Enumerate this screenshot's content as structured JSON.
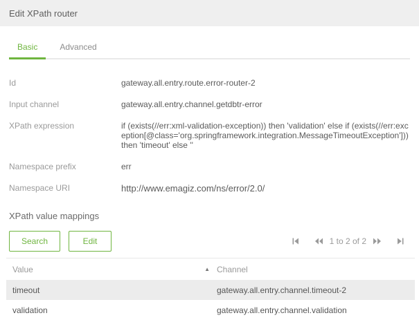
{
  "window": {
    "title": "Edit XPath router"
  },
  "tabs": [
    {
      "label": "Basic",
      "active": true
    },
    {
      "label": "Advanced",
      "active": false
    }
  ],
  "fields": [
    {
      "label": "Id",
      "value": "gateway.all.entry.route.error-router-2"
    },
    {
      "label": "Input channel",
      "value": "gateway.all.entry.channel.getdbtr-error"
    },
    {
      "label": "XPath expression",
      "value": "if (exists(//err:xml-validation-exception)) then 'validation' else if (exists(//err:exception[@class='org.springframework.integration.MessageTimeoutException'])) then 'timeout' else ''"
    },
    {
      "label": "Namespace prefix",
      "value": "err"
    },
    {
      "label": "Namespace URI",
      "value": "http://www.emagiz.com/ns/error/2.0/"
    }
  ],
  "mappings": {
    "section_title": "XPath value mappings",
    "buttons": {
      "search": "Search",
      "edit": "Edit"
    },
    "pagination": {
      "range_text": "1 to 2 of 2",
      "first_icon": "first-page-icon",
      "prev_icon": "previous-page-icon",
      "next_icon": "next-page-icon",
      "last_icon": "last-page-icon"
    },
    "table": {
      "columns": {
        "value": "Value",
        "channel": "Channel"
      },
      "sort": {
        "column": "Value",
        "direction": "ascending",
        "icon": "sort-ascending-icon"
      },
      "rows": [
        {
          "value": "timeout",
          "channel": "gateway.all.entry.channel.timeout-2",
          "highlighted": true
        },
        {
          "value": "validation",
          "channel": "gateway.all.entry.channel.validation",
          "highlighted": false
        }
      ]
    }
  },
  "colors": {
    "accent_green": "#6fb53f",
    "header_background": "#efefef",
    "row_highlight": "#ececec",
    "label_gray": "#9a9a9a"
  }
}
